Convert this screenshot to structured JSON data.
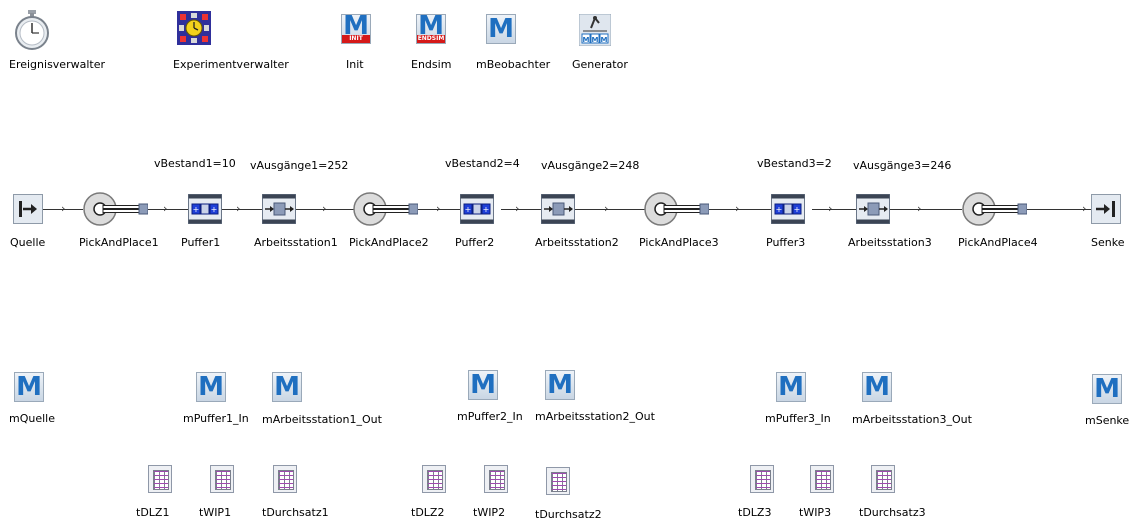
{
  "tools": {
    "ereignisverwalter": "Ereignisverwalter",
    "experimentverwalter": "Experimentverwalter",
    "init": "Init",
    "init_tag": "INIT",
    "endsim": "Endsim",
    "endsim_tag": "ENDSIM",
    "mbeobachter": "mBeobachter",
    "generator": "Generator",
    "method_glyph": "M"
  },
  "line": {
    "quelle": "Quelle",
    "pp1": "PickAndPlace1",
    "puffer1": "Puffer1",
    "as1": "Arbeitsstation1",
    "pp2": "PickAndPlace2",
    "puffer2": "Puffer2",
    "as2": "Arbeitsstation2",
    "pp3": "PickAndPlace3",
    "puffer3": "Puffer3",
    "as3": "Arbeitsstation3",
    "pp4": "PickAndPlace4",
    "senke": "Senke"
  },
  "variables": {
    "vbestand1": "vBestand1=10",
    "vausgaenge1": "vAusgänge1=252",
    "vbestand2": "vBestand2=4",
    "vausgaenge2": "vAusgänge2=248",
    "vbestand3": "vBestand3=2",
    "vausgaenge3": "vAusgänge3=246"
  },
  "methods": {
    "mquelle": "mQuelle",
    "mpuffer1_in": "mPuffer1_In",
    "mas1_out": "mArbeitsstation1_Out",
    "mpuffer2_in": "mPuffer2_In",
    "mas2_out": "mArbeitsstation2_Out",
    "mpuffer3_in": "mPuffer3_In",
    "mas3_out": "mArbeitsstation3_Out",
    "msenke": "mSenke"
  },
  "tables": {
    "tdlz1": "tDLZ1",
    "twip1": "tWIP1",
    "tdurchsatz1": "tDurchsatz1",
    "tdlz2": "tDLZ2",
    "twip2": "tWIP2",
    "tdurchsatz2": "tDurchsatz2",
    "tdlz3": "tDLZ3",
    "twip3": "tWIP3",
    "tdurchsatz3": "tDurchsatz3"
  },
  "colors": {
    "method_blue": "#1f6fc0",
    "tag_red": "#d51919",
    "buffer_blue": "#1e3fd8",
    "station_gray": "#8c9bb8"
  },
  "icons": {
    "ereignisverwalter": "stopwatch-icon",
    "experimentverwalter": "experiment-clock-icon",
    "generator": "generator-icon",
    "quelle": "source-icon",
    "pickandplace": "robot-arm-icon",
    "puffer": "buffer-icon",
    "arbeitsstation": "workstation-icon",
    "senke": "drain-icon",
    "method": "method-icon",
    "table": "table-icon"
  }
}
